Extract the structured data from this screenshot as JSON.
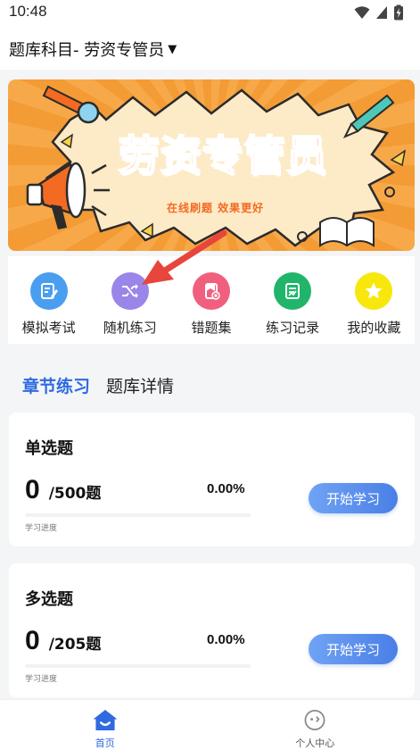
{
  "status_bar": {
    "time": "10:48"
  },
  "header": {
    "subject": "题库科目- 劳资专管员",
    "caret": "▼"
  },
  "banner": {
    "title": "劳资专管员",
    "slogan": "在线刷题  效果更好"
  },
  "quick_menu": [
    {
      "label": "模拟考试",
      "icon": "exam-icon",
      "color": "#4a9ef0"
    },
    {
      "label": "随机练习",
      "icon": "shuffle-icon",
      "color": "#9a85e8"
    },
    {
      "label": "错题集",
      "icon": "wrong-questions-icon",
      "color": "#f0607e"
    },
    {
      "label": "练习记录",
      "icon": "record-icon",
      "color": "#20b56a"
    },
    {
      "label": "我的收藏",
      "icon": "star-icon",
      "color": "#f7e70c"
    }
  ],
  "tabs": [
    {
      "label": "章节练习",
      "active": true
    },
    {
      "label": "题库详情",
      "active": false
    }
  ],
  "cards": [
    {
      "title": "单选题",
      "done": "0",
      "total": "/500题",
      "percent": "0.00%",
      "progress": 0,
      "progress_label": "学习进度",
      "button": "开始学习"
    },
    {
      "title": "多选题",
      "done": "0",
      "total": "/205题",
      "percent": "0.00%",
      "progress": 0,
      "progress_label": "学习进度",
      "button": "开始学习"
    }
  ],
  "bottom_nav": [
    {
      "label": "首页",
      "icon": "home-icon",
      "active": true
    },
    {
      "label": "个人中心",
      "icon": "profile-icon",
      "active": false
    }
  ],
  "colors": {
    "accent": "#2f6be0",
    "banner_orange": "#f39b35",
    "arrow_red": "#e8453c"
  }
}
